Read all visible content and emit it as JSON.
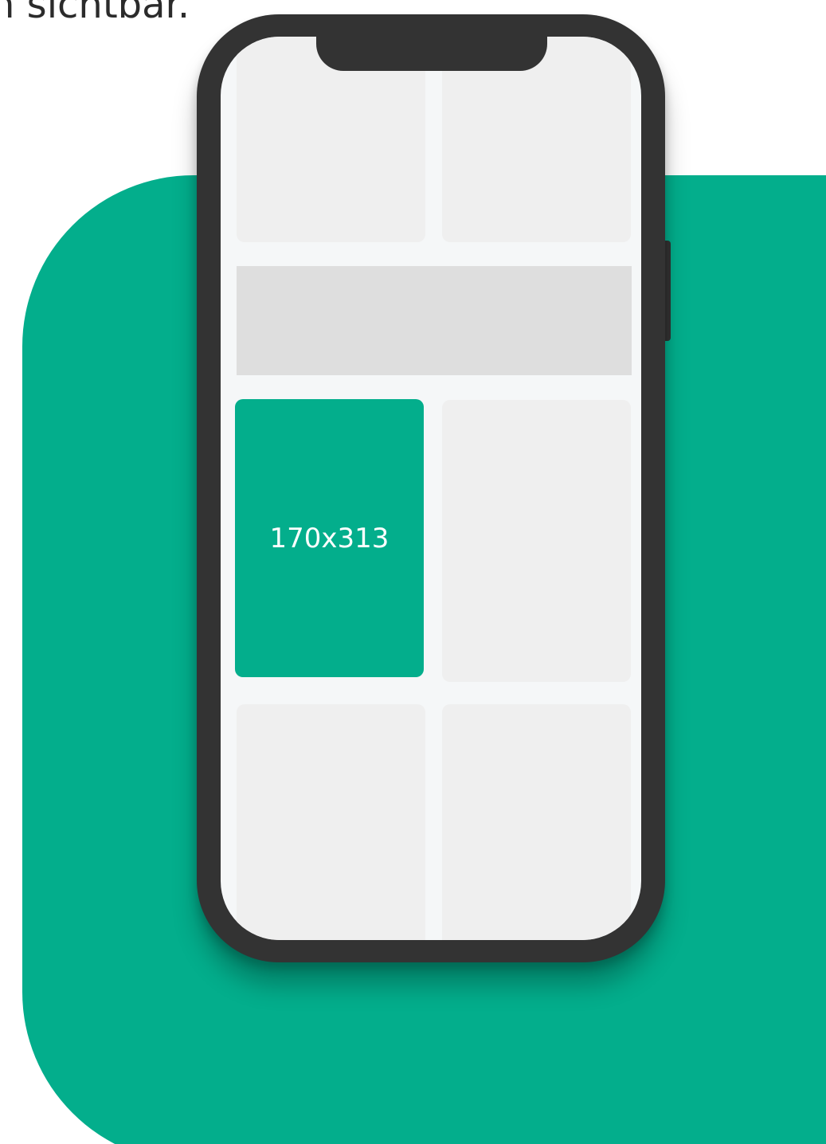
{
  "caption": {
    "text": "n sichtbar."
  },
  "highlight_tile": {
    "label": "170x313"
  },
  "colors": {
    "accent": "#03ae8c",
    "device_frame": "#333333",
    "screen_background": "#f5f7f8",
    "tile_placeholder": "#efefef",
    "banner_placeholder": "#dedede"
  }
}
